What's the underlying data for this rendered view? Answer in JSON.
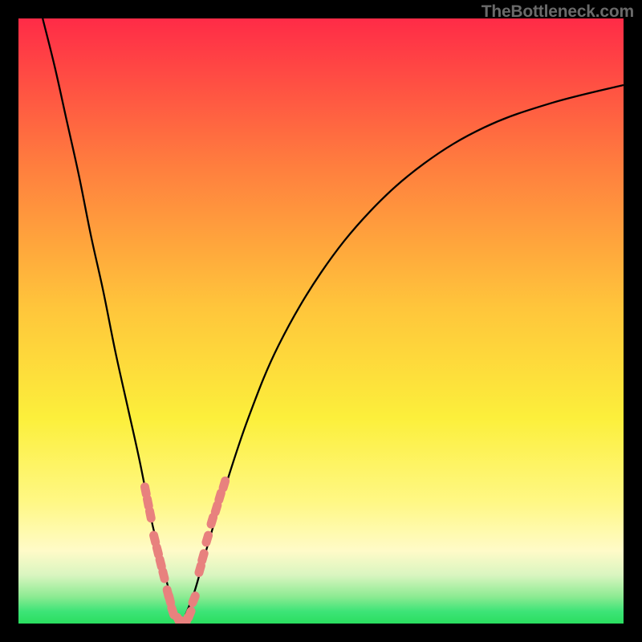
{
  "watermark": "TheBottleneck.com",
  "colors": {
    "red": "#ff2b47",
    "orange": "#ffa33a",
    "yellow": "#fcef3b",
    "pale_yellow": "#fff9b7",
    "pale_green": "#bff5b0",
    "green": "#2ade5f",
    "marker": "#e8817e",
    "curve": "#000000",
    "frame_bg": "#000000"
  },
  "gradient_stops": [
    {
      "offset": 0.0,
      "color": "#ff2b47"
    },
    {
      "offset": 0.25,
      "color": "#ff803e"
    },
    {
      "offset": 0.48,
      "color": "#ffc63b"
    },
    {
      "offset": 0.66,
      "color": "#fcef3b"
    },
    {
      "offset": 0.8,
      "color": "#fff885"
    },
    {
      "offset": 0.88,
      "color": "#fffbc8"
    },
    {
      "offset": 0.92,
      "color": "#d9f5c0"
    },
    {
      "offset": 0.955,
      "color": "#8eeb93"
    },
    {
      "offset": 0.98,
      "color": "#3de477"
    },
    {
      "offset": 1.0,
      "color": "#2ade5f"
    }
  ],
  "chart_data": {
    "type": "line",
    "title": "",
    "xlabel": "",
    "ylabel": "",
    "x_range": [
      0,
      100
    ],
    "y_range": [
      0,
      100
    ],
    "note": "Two-curve bottleneck profile. X is an implicit component-balance axis; Y is bottleneck severity (0 = no bottleneck / green, 100 = max bottleneck / red). Both curves meet near zero around x≈25.",
    "series": [
      {
        "name": "left_curve",
        "description": "Steep descending curve from top-left to the valley.",
        "x": [
          4,
          6,
          8,
          10,
          12,
          14,
          16,
          18,
          20,
          22,
          23,
          24,
          25,
          26,
          27
        ],
        "y": [
          100,
          92,
          83,
          74,
          64,
          55,
          45,
          36,
          27,
          17,
          13,
          9,
          5,
          2,
          0
        ]
      },
      {
        "name": "right_curve",
        "description": "Shallow ascending-then-flattening curve from the valley toward the upper-right.",
        "x": [
          27,
          29,
          31,
          34,
          38,
          43,
          50,
          58,
          67,
          77,
          88,
          100
        ],
        "y": [
          0,
          5,
          12,
          22,
          34,
          46,
          58,
          68,
          76,
          82,
          86,
          89
        ]
      }
    ],
    "markers": {
      "description": "Pill-shaped coral markers clustered along both curves near the valley.",
      "points": [
        {
          "series": "left_curve",
          "x": 21.0,
          "y": 22
        },
        {
          "series": "left_curve",
          "x": 21.4,
          "y": 20
        },
        {
          "series": "left_curve",
          "x": 21.8,
          "y": 18
        },
        {
          "series": "left_curve",
          "x": 22.5,
          "y": 14
        },
        {
          "series": "left_curve",
          "x": 23.0,
          "y": 12
        },
        {
          "series": "left_curve",
          "x": 23.5,
          "y": 10
        },
        {
          "series": "left_curve",
          "x": 24.0,
          "y": 8
        },
        {
          "series": "left_curve",
          "x": 24.7,
          "y": 5
        },
        {
          "series": "left_curve",
          "x": 25.0,
          "y": 4
        },
        {
          "series": "left_curve",
          "x": 25.5,
          "y": 2
        },
        {
          "series": "left_curve",
          "x": 26.5,
          "y": 0.5
        },
        {
          "series": "left_curve",
          "x": 27.0,
          "y": 0
        },
        {
          "series": "right_curve",
          "x": 27.8,
          "y": 0.5
        },
        {
          "series": "right_curve",
          "x": 28.3,
          "y": 1.5
        },
        {
          "series": "right_curve",
          "x": 29.0,
          "y": 4
        },
        {
          "series": "right_curve",
          "x": 30.0,
          "y": 9
        },
        {
          "series": "right_curve",
          "x": 30.5,
          "y": 11
        },
        {
          "series": "right_curve",
          "x": 31.2,
          "y": 14
        },
        {
          "series": "right_curve",
          "x": 32.0,
          "y": 17
        },
        {
          "series": "right_curve",
          "x": 32.7,
          "y": 19
        },
        {
          "series": "right_curve",
          "x": 33.3,
          "y": 21
        },
        {
          "series": "right_curve",
          "x": 34.0,
          "y": 23
        }
      ]
    }
  }
}
